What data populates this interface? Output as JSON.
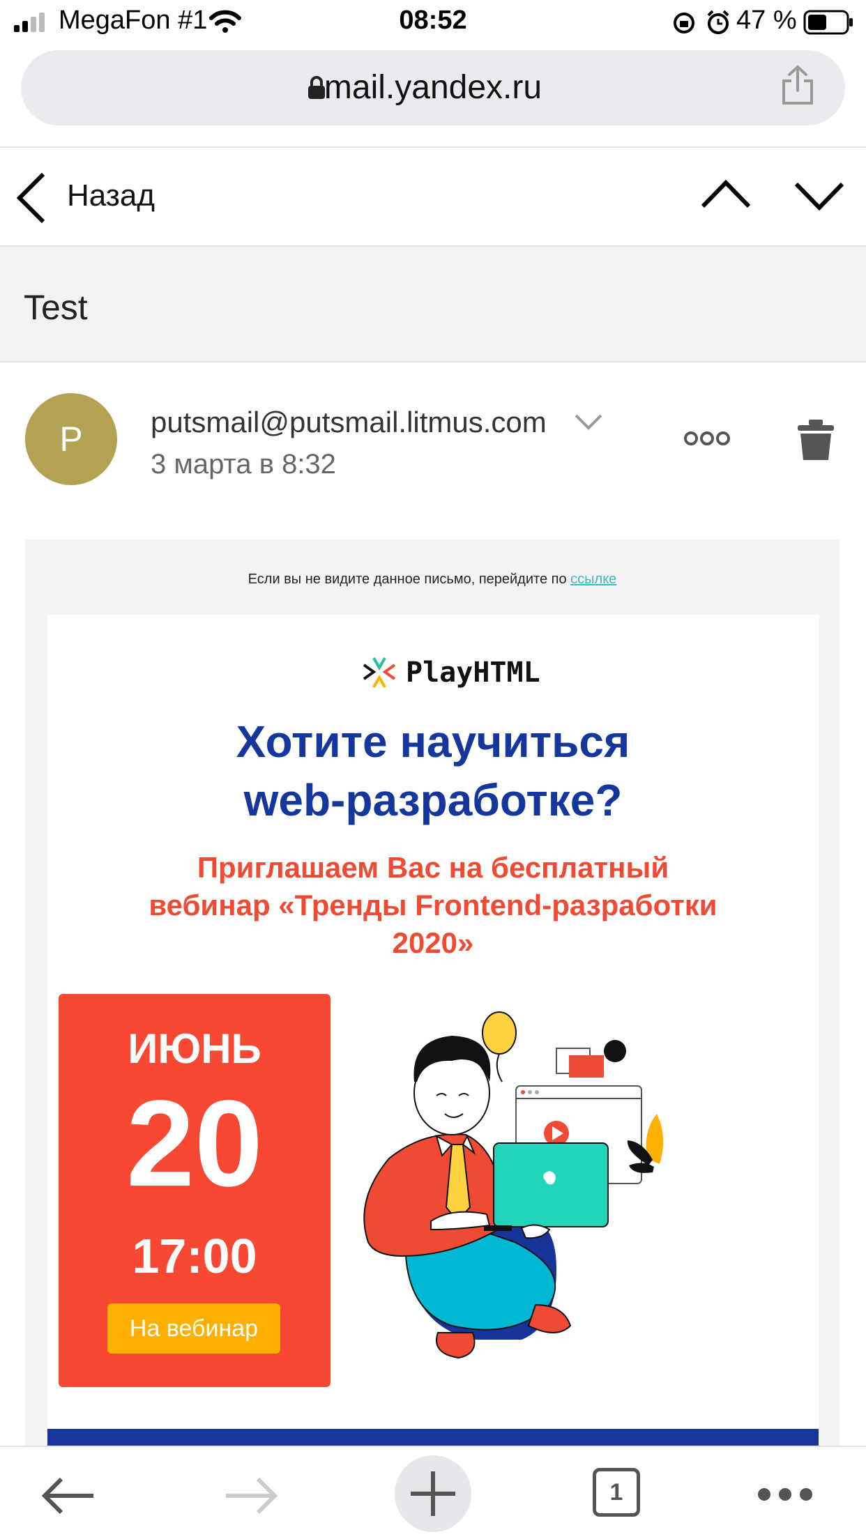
{
  "status_bar": {
    "carrier": "MegaFon #1",
    "time": "08:52",
    "battery": "47 %"
  },
  "browser": {
    "url": "mail.yandex.ru"
  },
  "nav": {
    "back_label": "Назад"
  },
  "message": {
    "subject": "Test",
    "avatar_letter": "P",
    "sender": "putsmail@putsmail.litmus.com",
    "date": "3 марта в 8:32"
  },
  "email": {
    "preheader_text": "Если вы не видите данное письмо, перейдите по ",
    "preheader_link": "ссылке",
    "brand": "PlayHTML",
    "headline_line1": "Хотите научиться",
    "headline_line2": "web-разработке?",
    "subhead_line1": "Приглашаем Вас на бесплатный",
    "subhead_line2": "вебинар «Тренды Frontend-разработки",
    "subhead_line3": "2020»",
    "month": "ИЮНЬ",
    "day": "20",
    "time": "17:00",
    "cta_label": "На вебинар"
  },
  "toolbar": {
    "tabs_count": "1"
  },
  "colors": {
    "accent_blue": "#15379b",
    "accent_red": "#ef4b34",
    "cta_yellow": "#fdb000",
    "avatar": "#b3a254"
  }
}
